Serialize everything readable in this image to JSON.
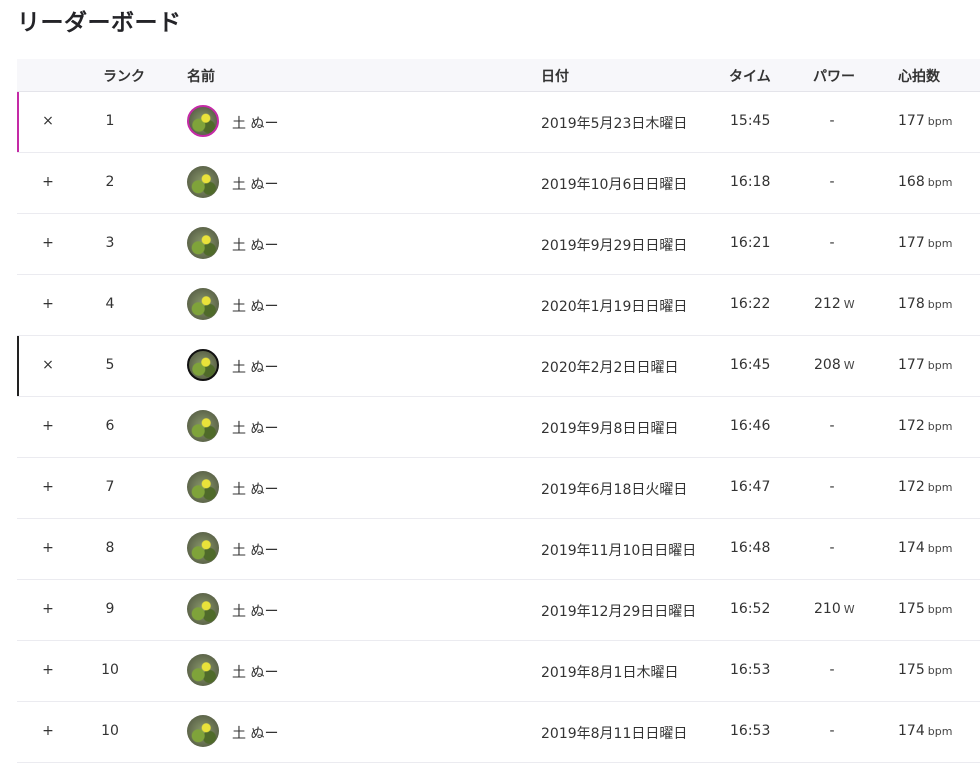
{
  "page": {
    "title": "リーダーボード"
  },
  "headers": {
    "rank": "ランク",
    "name": "名前",
    "date": "日付",
    "time": "タイム",
    "power": "パワー",
    "hr": "心拍数"
  },
  "colors": {
    "highlight_pink": "#c42aa6",
    "highlight_black": "#222222",
    "header_bg": "#f7f7fa"
  },
  "rows": [
    {
      "toggle": "×",
      "rank": "1",
      "name": "土 ぬー",
      "date": "2019年5月23日木曜日",
      "time": "15:45",
      "power": "-",
      "power_unit": "",
      "hr": "177",
      "hr_unit": "bpm",
      "highlight": "pink"
    },
    {
      "toggle": "+",
      "rank": "2",
      "name": "土 ぬー",
      "date": "2019年10月6日日曜日",
      "time": "16:18",
      "power": "-",
      "power_unit": "",
      "hr": "168",
      "hr_unit": "bpm",
      "highlight": ""
    },
    {
      "toggle": "+",
      "rank": "3",
      "name": "土 ぬー",
      "date": "2019年9月29日日曜日",
      "time": "16:21",
      "power": "-",
      "power_unit": "",
      "hr": "177",
      "hr_unit": "bpm",
      "highlight": ""
    },
    {
      "toggle": "+",
      "rank": "4",
      "name": "土 ぬー",
      "date": "2020年1月19日日曜日",
      "time": "16:22",
      "power": "212",
      "power_unit": "W",
      "hr": "178",
      "hr_unit": "bpm",
      "highlight": ""
    },
    {
      "toggle": "×",
      "rank": "5",
      "name": "土 ぬー",
      "date": "2020年2月2日日曜日",
      "time": "16:45",
      "power": "208",
      "power_unit": "W",
      "hr": "177",
      "hr_unit": "bpm",
      "highlight": "black"
    },
    {
      "toggle": "+",
      "rank": "6",
      "name": "土 ぬー",
      "date": "2019年9月8日日曜日",
      "time": "16:46",
      "power": "-",
      "power_unit": "",
      "hr": "172",
      "hr_unit": "bpm",
      "highlight": ""
    },
    {
      "toggle": "+",
      "rank": "7",
      "name": "土 ぬー",
      "date": "2019年6月18日火曜日",
      "time": "16:47",
      "power": "-",
      "power_unit": "",
      "hr": "172",
      "hr_unit": "bpm",
      "highlight": ""
    },
    {
      "toggle": "+",
      "rank": "8",
      "name": "土 ぬー",
      "date": "2019年11月10日日曜日",
      "time": "16:48",
      "power": "-",
      "power_unit": "",
      "hr": "174",
      "hr_unit": "bpm",
      "highlight": ""
    },
    {
      "toggle": "+",
      "rank": "9",
      "name": "土 ぬー",
      "date": "2019年12月29日日曜日",
      "time": "16:52",
      "power": "210",
      "power_unit": "W",
      "hr": "175",
      "hr_unit": "bpm",
      "highlight": ""
    },
    {
      "toggle": "+",
      "rank": "10",
      "name": "土 ぬー",
      "date": "2019年8月1日木曜日",
      "time": "16:53",
      "power": "-",
      "power_unit": "",
      "hr": "175",
      "hr_unit": "bpm",
      "highlight": ""
    },
    {
      "toggle": "+",
      "rank": "10",
      "name": "土 ぬー",
      "date": "2019年8月11日日曜日",
      "time": "16:53",
      "power": "-",
      "power_unit": "",
      "hr": "174",
      "hr_unit": "bpm",
      "highlight": ""
    }
  ]
}
